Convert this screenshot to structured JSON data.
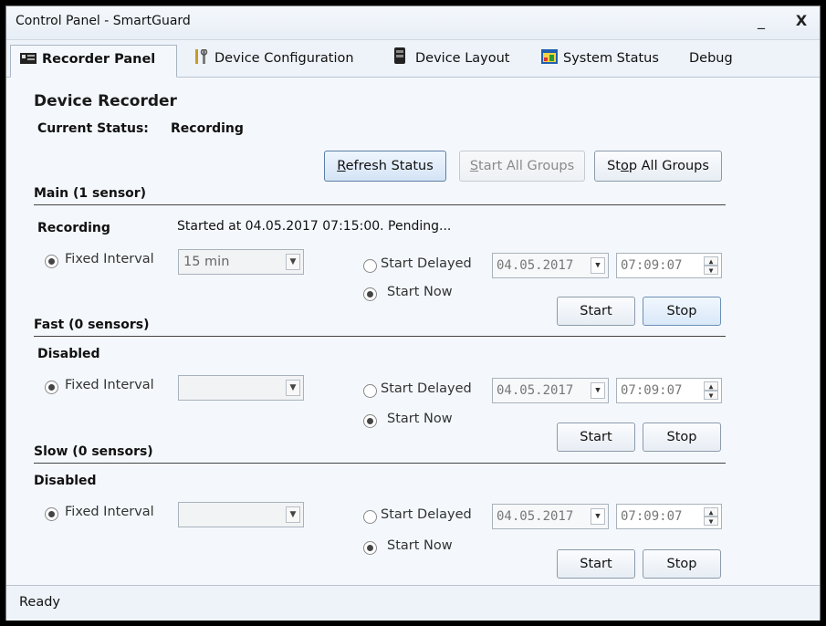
{
  "window": {
    "title": "Control Panel - SmartGuard",
    "minimize_label": "_",
    "close_label": "X"
  },
  "tabs": [
    {
      "label": "Recorder Panel",
      "icon": "recorder-icon",
      "active": true
    },
    {
      "label": "Device Configuration",
      "icon": "tools-icon",
      "active": false
    },
    {
      "label": "Device Layout",
      "icon": "device-icon",
      "active": false
    },
    {
      "label": "System Status",
      "icon": "status-window-icon",
      "active": false
    },
    {
      "label": "Debug",
      "icon": "",
      "active": false
    }
  ],
  "recorder": {
    "heading": "Device Recorder",
    "current_status_label": "Current Status:",
    "current_status_value": "Recording",
    "refresh_rest": "efresh Status",
    "refresh_key": "R",
    "start_all_rest": "tart All Groups",
    "start_all_key": "S",
    "stop_all_prefix": "St",
    "stop_all_key": "o",
    "stop_all_rest": "p All Groups"
  },
  "groups": [
    {
      "title": "Main (1 sensor)",
      "state": "Recording",
      "message": "Started at 04.05.2017 07:15:00. Pending...",
      "fixed_interval_label": "Fixed Interval",
      "interval_value": "15 min",
      "start_delayed_label": "Start Delayed",
      "start_now_label": "Start Now",
      "date": "04.05.2017",
      "time": "07:09:07",
      "start_label": "Start",
      "stop_label": "Stop"
    },
    {
      "title": "Fast (0 sensors)",
      "state": "Disabled",
      "message": "",
      "fixed_interval_label": "Fixed Interval",
      "interval_value": "",
      "start_delayed_label": "Start Delayed",
      "start_now_label": "Start Now",
      "date": "04.05.2017",
      "time": "07:09:07",
      "start_label": "Start",
      "stop_label": "Stop"
    },
    {
      "title": "Slow (0 sensors)",
      "state": "Disabled",
      "message": "",
      "fixed_interval_label": "Fixed Interval",
      "interval_value": "",
      "start_delayed_label": "Start Delayed",
      "start_now_label": "Start Now",
      "date": "04.05.2017",
      "time": "07:09:07",
      "start_label": "Start",
      "stop_label": "Stop"
    }
  ],
  "statusbar": {
    "text": "Ready"
  }
}
